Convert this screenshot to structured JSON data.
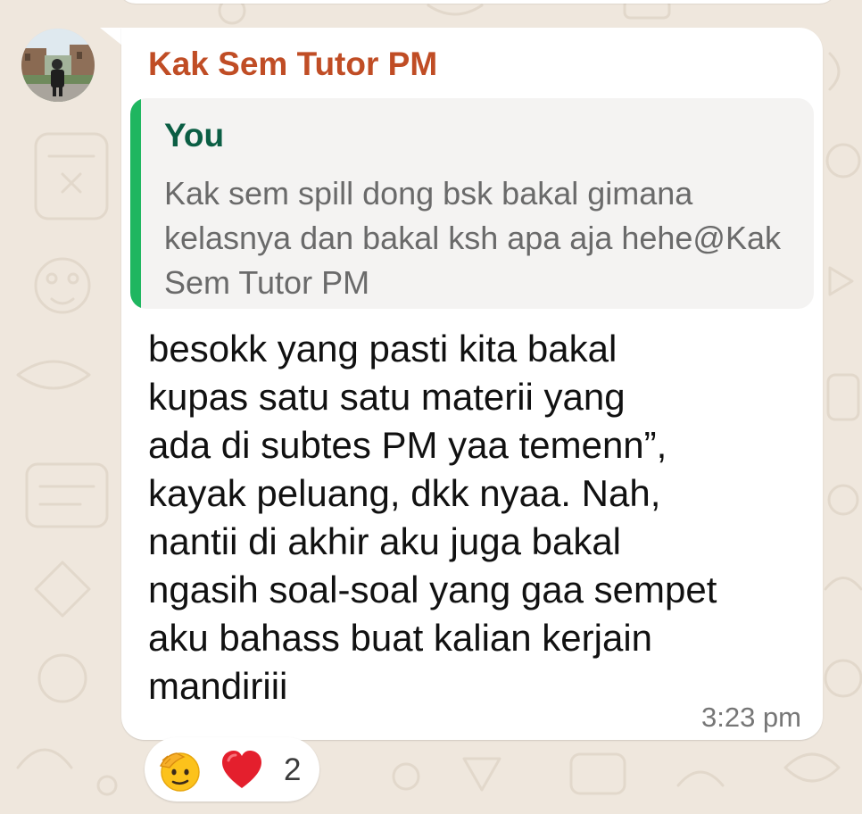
{
  "message": {
    "sender_name": "Kak Sem Tutor PM",
    "quoted": {
      "author": "You",
      "text": "Kak sem spill dong bsk bakal gimana kelasnya dan bakal ksh apa aja hehe@Kak Sem Tutor PM"
    },
    "body_lines": [
      "besokk yang pasti kita bakal",
      "kupas satu satu materii yang",
      "ada di subtes PM yaa temenn”,",
      "kayak peluang, dkk nyaa. Nah,",
      "nantii di akhir aku juga bakal",
      "ngasih soal-soal yang gaa sempet",
      "aku bahass buat kalian kerjain",
      "mandiriii"
    ],
    "time": "3:23 pm"
  },
  "reactions": {
    "emojis": [
      "saluting-face",
      "red-heart"
    ],
    "count": "2"
  },
  "colors": {
    "sender": "#c04d25",
    "quote_author": "#0b5e44",
    "quote_bar": "#1fb660",
    "chat_background": "#efe7dd"
  }
}
